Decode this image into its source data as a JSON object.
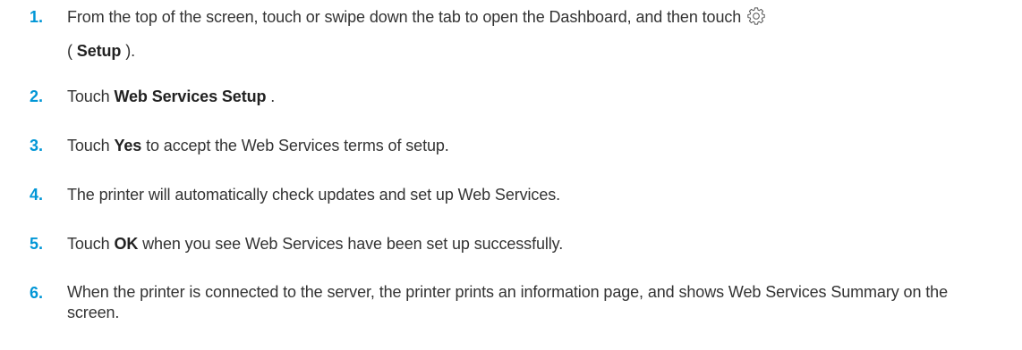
{
  "steps": [
    {
      "number": "1.",
      "before": "From the top of the screen, touch or swipe down the tab to open the Dashboard, and then touch",
      "icon": "gear-icon",
      "paren_open": "( ",
      "bold": "Setup",
      "paren_close": " )."
    },
    {
      "number": "2.",
      "before": "Touch ",
      "bold": "Web Services Setup",
      "after": " ."
    },
    {
      "number": "3.",
      "before": "Touch ",
      "bold": "Yes",
      "after": " to accept the Web Services terms of setup."
    },
    {
      "number": "4.",
      "text": "The printer will automatically check updates and set up Web Services."
    },
    {
      "number": "5.",
      "before": "Touch ",
      "bold": "OK",
      "after": " when you see Web Services have been set up successfully."
    },
    {
      "number": "6.",
      "text": "When the printer is connected to the server, the printer prints an information page, and shows Web Services Summary on the screen."
    }
  ],
  "colors": {
    "step_number": "#0096d6",
    "body_text": "#333333"
  }
}
